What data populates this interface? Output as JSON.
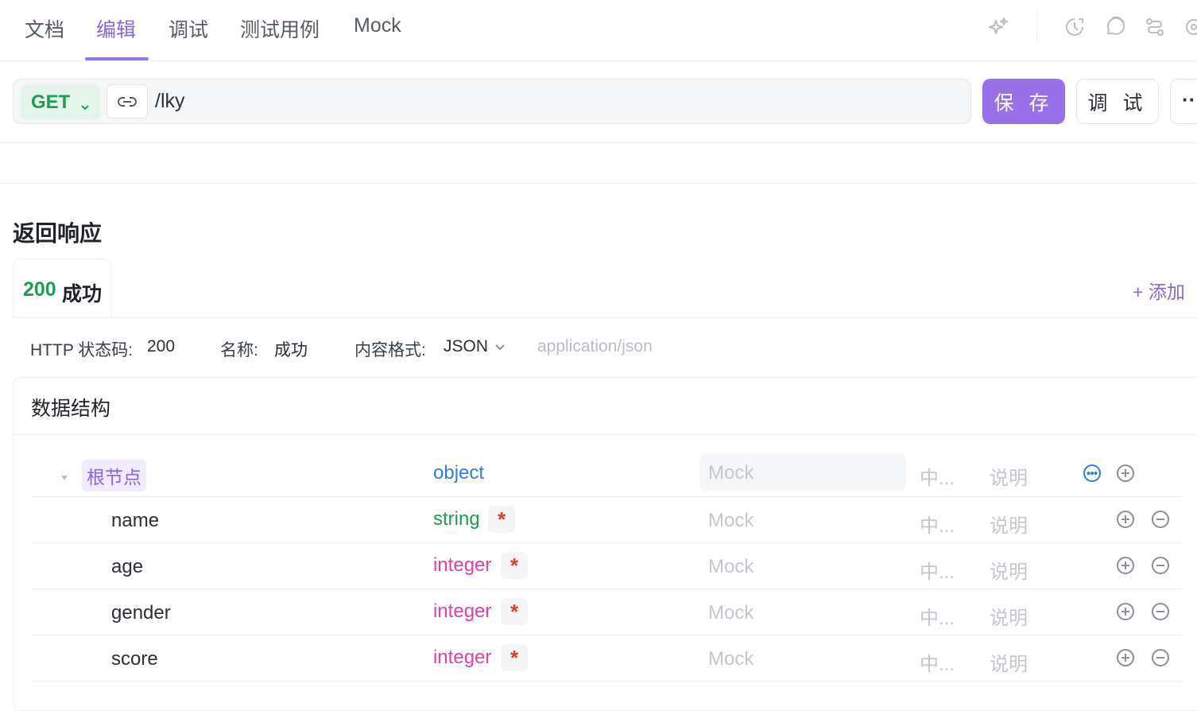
{
  "tabs": [
    {
      "label": "文档",
      "active": false
    },
    {
      "label": "编辑",
      "active": true
    },
    {
      "label": "调试",
      "active": false
    },
    {
      "label": "测试用例",
      "active": false
    },
    {
      "label": "Mock",
      "active": false
    }
  ],
  "toolbar_icons": [
    "sparkle-icon",
    "history-icon",
    "comment-icon",
    "flow-icon",
    "settings-icon"
  ],
  "request": {
    "method": "GET",
    "path": "/lky",
    "save_label": "保 存",
    "debug_label": "调 试",
    "more_label": "··"
  },
  "response_section": {
    "title": "返回响应",
    "tab": {
      "code": "200",
      "name": "成功"
    },
    "add_label": "+ 添加",
    "status_label": "HTTP 状态码:",
    "status_value": "200",
    "name_label": "名称:",
    "name_value": "成功",
    "format_label": "内容格式:",
    "format_value": "JSON",
    "content_type_placeholder": "application/json"
  },
  "data_structure": {
    "title": "数据结构",
    "root": {
      "name": "根节点",
      "type": "object",
      "mock": "Mock",
      "cn": "中...",
      "desc": "说明"
    },
    "fields": [
      {
        "name": "name",
        "type": "string",
        "required": "*",
        "mock": "Mock",
        "cn": "中...",
        "desc": "说明"
      },
      {
        "name": "age",
        "type": "integer",
        "required": "*",
        "mock": "Mock",
        "cn": "中...",
        "desc": "说明"
      },
      {
        "name": "gender",
        "type": "integer",
        "required": "*",
        "mock": "Mock",
        "cn": "中...",
        "desc": "说明"
      },
      {
        "name": "score",
        "type": "integer",
        "required": "*",
        "mock": "Mock",
        "cn": "中...",
        "desc": "说明"
      }
    ]
  },
  "colors": {
    "accent": "#9a6fea",
    "get": "#1f9d55",
    "object": "#2d7fe0",
    "string": "#1f9d55",
    "integer": "#e040a8",
    "required": "#e53935"
  }
}
